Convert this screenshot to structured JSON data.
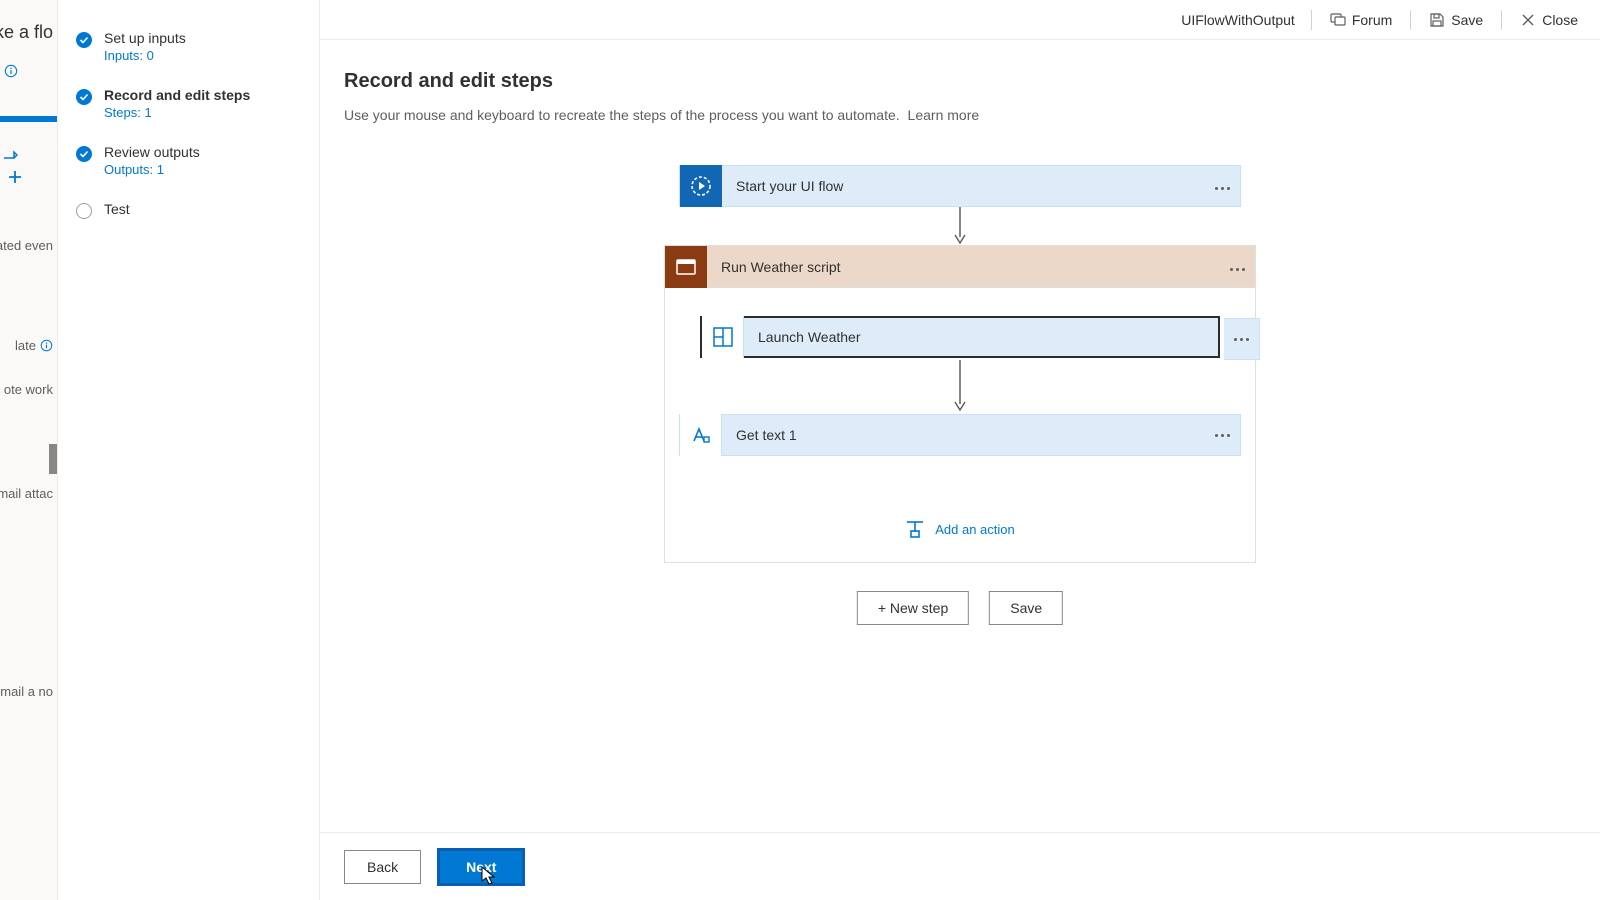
{
  "bg": {
    "header": "ake a flo",
    "frag1": "gnated even",
    "frag2": "late",
    "frag3": "ote work",
    "frag4": "email attac",
    "frag5": "email a no"
  },
  "wizard": {
    "steps": [
      {
        "title": "Set up inputs",
        "sub": "Inputs: 0",
        "state": "done"
      },
      {
        "title": "Record and edit steps",
        "sub": "Steps: 1",
        "state": "done",
        "active": true
      },
      {
        "title": "Review outputs",
        "sub": "Outputs: 1",
        "state": "done"
      },
      {
        "title": "Test",
        "sub": "",
        "state": "pending"
      }
    ]
  },
  "topbar": {
    "flow_name": "UIFlowWithOutput",
    "forum": "Forum",
    "save": "Save",
    "close": "Close"
  },
  "page": {
    "heading": "Record and edit steps",
    "description": "Use your mouse and keyboard to recreate the steps of the process you want to automate.",
    "learn_more": "Learn more"
  },
  "flow": {
    "start": "Start your UI flow",
    "script_name": "Run Weather script",
    "actions": [
      {
        "label": "Launch Weather",
        "icon": "app"
      },
      {
        "label": "Get text 1",
        "icon": "text"
      }
    ],
    "add_action": "Add an action"
  },
  "canvas_buttons": {
    "new_step": "+ New step",
    "save": "Save"
  },
  "footer": {
    "back": "Back",
    "next": "Next"
  }
}
